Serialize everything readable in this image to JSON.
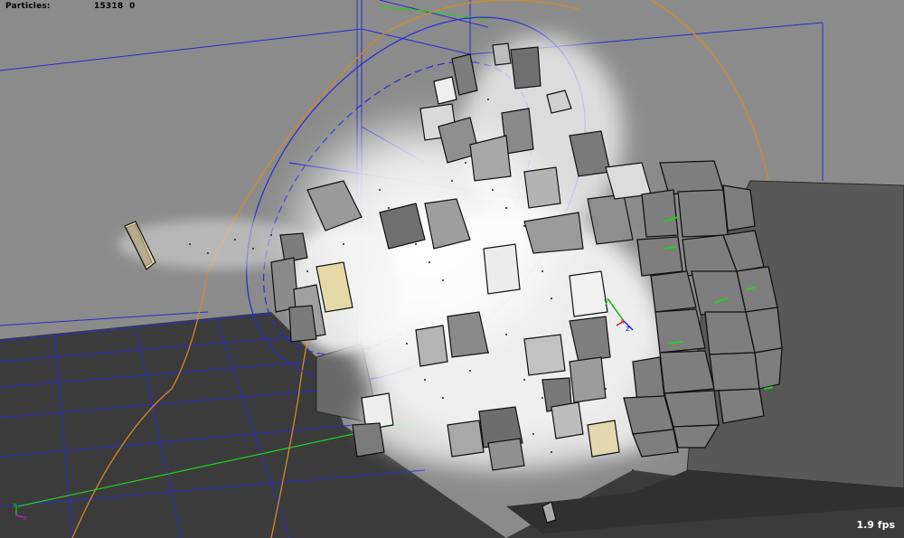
{
  "hud": {
    "particles_label": "Particles:",
    "particles_count": "15318",
    "particles_extra": "0"
  },
  "status": {
    "fps": "1.9 fps"
  },
  "manipulator": {
    "x_label": "x",
    "y_label": "y",
    "z_label": "z"
  },
  "gizmo": {
    "y_label": "y",
    "z_label": "z"
  },
  "colors": {
    "viewport_bg": "#8b8b8b",
    "floor": "#3a3a3a",
    "wall_block": "#555555",
    "grid_lines": "#2b2bd0",
    "guide_curve": "#d08a2a",
    "green_guides": "#22d022",
    "debris_fill": "#8f8f8f",
    "dust": "#f2f2f2"
  }
}
